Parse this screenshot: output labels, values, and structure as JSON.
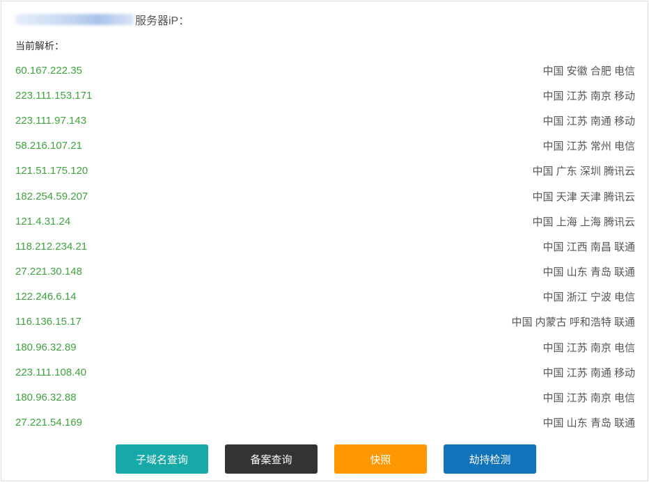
{
  "header": {
    "title_suffix": "服务器iP：",
    "subtitle": "当前解析："
  },
  "records": [
    {
      "ip": "60.167.222.35",
      "location": "中国 安徽 合肥 电信"
    },
    {
      "ip": "223.111.153.171",
      "location": "中国 江苏 南京 移动"
    },
    {
      "ip": "223.111.97.143",
      "location": "中国 江苏 南通 移动"
    },
    {
      "ip": "58.216.107.21",
      "location": "中国 江苏 常州 电信"
    },
    {
      "ip": "121.51.175.120",
      "location": "中国 广东 深圳 腾讯云"
    },
    {
      "ip": "182.254.59.207",
      "location": "中国 天津 天津 腾讯云"
    },
    {
      "ip": "121.4.31.24",
      "location": "中国 上海 上海 腾讯云"
    },
    {
      "ip": "118.212.234.21",
      "location": "中国 江西 南昌 联通"
    },
    {
      "ip": "27.221.30.148",
      "location": "中国 山东 青岛 联通"
    },
    {
      "ip": "122.246.6.14",
      "location": "中国 浙江 宁波 电信"
    },
    {
      "ip": "116.136.15.17",
      "location": "中国 内蒙古 呼和浩特 联通"
    },
    {
      "ip": "180.96.32.89",
      "location": "中国 江苏 南京 电信"
    },
    {
      "ip": "223.111.108.40",
      "location": "中国 江苏 南通 移动"
    },
    {
      "ip": "180.96.32.88",
      "location": "中国 江苏 南京 电信"
    },
    {
      "ip": "27.221.54.169",
      "location": "中国 山东 青岛 联通"
    }
  ],
  "buttons": [
    {
      "label": "子域名查询",
      "color": "#17a8a8"
    },
    {
      "label": "备案查询",
      "color": "#333333"
    },
    {
      "label": "快照",
      "color": "#ff9800"
    },
    {
      "label": "劫持检测",
      "color": "#1173b9"
    }
  ],
  "colors": {
    "ip_text": "#3ea23e",
    "location_text": "#555555"
  }
}
